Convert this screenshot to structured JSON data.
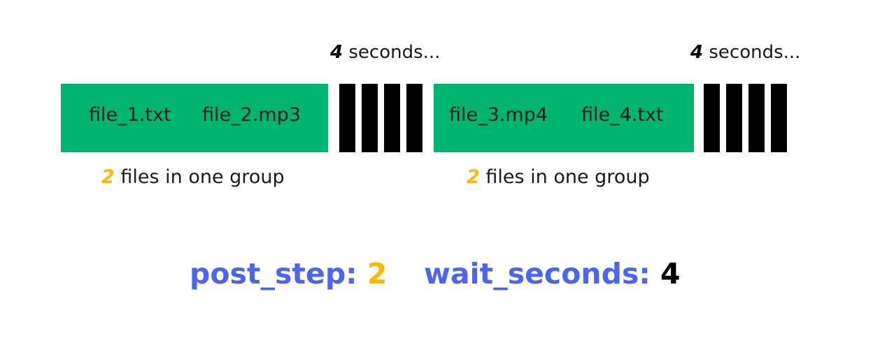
{
  "colors": {
    "group_fill": "#00b571",
    "wait_bar": "#000000",
    "accent_number": "#ffb800",
    "param_key": "#4a65f0"
  },
  "waits": [
    {
      "number": "4",
      "text": " seconds..."
    },
    {
      "number": "4",
      "text": " seconds..."
    }
  ],
  "groups": [
    {
      "files": [
        "file_1.txt",
        "file_2.mp3"
      ],
      "caption_number": "2",
      "caption_text": " files in one group"
    },
    {
      "files": [
        "file_3.mp4",
        "file_4.txt"
      ],
      "caption_number": "2",
      "caption_text": " files in one group"
    }
  ],
  "params": {
    "post_step_label": "post_step:",
    "post_step_value": "2",
    "wait_seconds_label": "wait_seconds:",
    "wait_seconds_value": "4"
  }
}
